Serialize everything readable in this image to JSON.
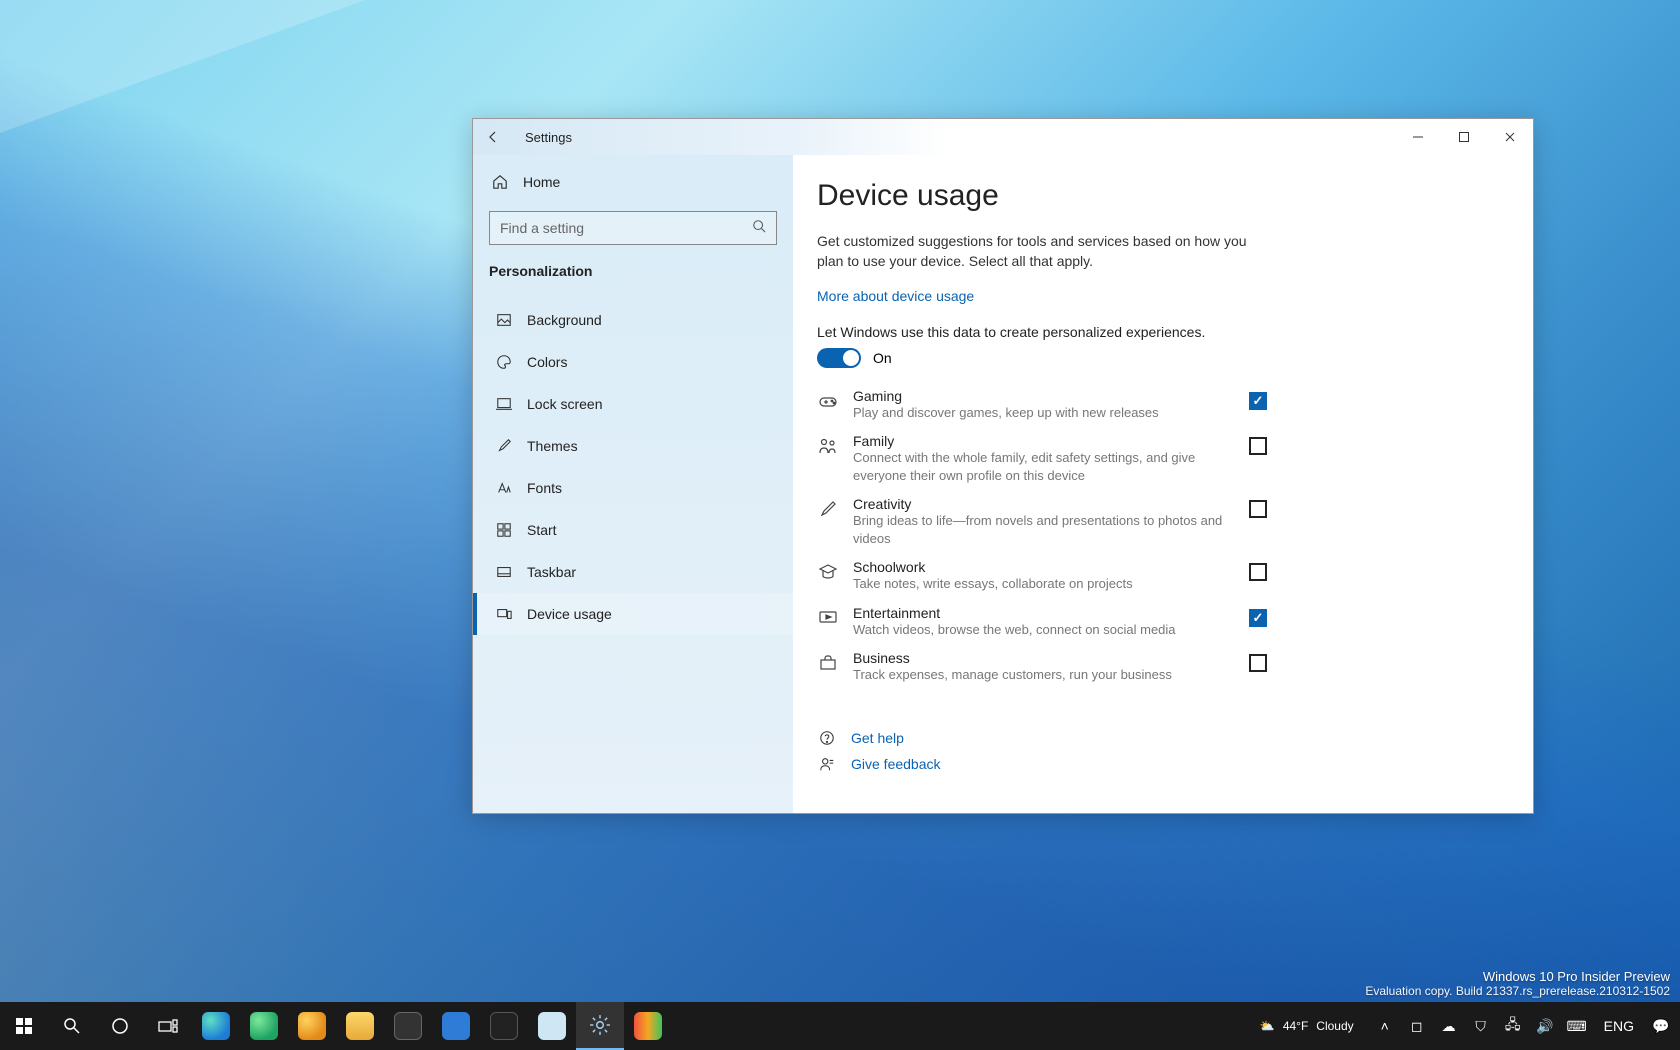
{
  "window": {
    "title": "Settings",
    "home": "Home",
    "search_placeholder": "Find a setting",
    "section": "Personalization"
  },
  "sidebar": {
    "items": [
      {
        "label": "Background"
      },
      {
        "label": "Colors"
      },
      {
        "label": "Lock screen"
      },
      {
        "label": "Themes"
      },
      {
        "label": "Fonts"
      },
      {
        "label": "Start"
      },
      {
        "label": "Taskbar"
      },
      {
        "label": "Device usage"
      }
    ]
  },
  "main": {
    "title": "Device usage",
    "description": "Get customized suggestions for tools and services based on how you plan to use your device. Select all that apply.",
    "more_link": "More about device usage",
    "toggle_label": "Let Windows use this data to create personalized experiences.",
    "toggle_state": "On",
    "options": [
      {
        "title": "Gaming",
        "desc": "Play and discover games, keep up with new releases",
        "checked": true
      },
      {
        "title": "Family",
        "desc": "Connect with the whole family, edit safety settings, and give everyone their own profile on this device",
        "checked": false
      },
      {
        "title": "Creativity",
        "desc": "Bring ideas to life—from novels and presentations to photos and videos",
        "checked": false
      },
      {
        "title": "Schoolwork",
        "desc": "Take notes, write essays, collaborate on projects",
        "checked": false
      },
      {
        "title": "Entertainment",
        "desc": "Watch videos, browse the web, connect on social media",
        "checked": true
      },
      {
        "title": "Business",
        "desc": "Track expenses, manage customers, run your business",
        "checked": false
      }
    ],
    "help": "Get help",
    "feedback": "Give feedback"
  },
  "taskbar": {
    "weather_temp": "44°F",
    "weather_cond": "Cloudy",
    "lang": "ENG"
  },
  "watermark": {
    "line1": "Windows 10 Pro Insider Preview",
    "line2": "Evaluation copy. Build 21337.rs_prerelease.210312-1502"
  },
  "colors": {
    "accent": "#0a63b1"
  }
}
